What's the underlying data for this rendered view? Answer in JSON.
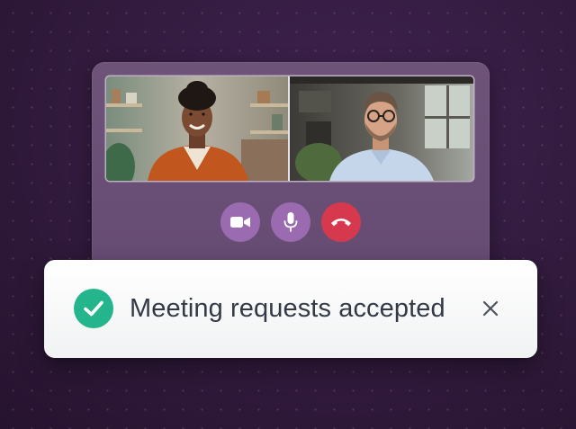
{
  "call": {
    "participants": [
      {
        "position": "left",
        "description": "woman in orange blazer"
      },
      {
        "position": "right",
        "description": "man with glasses in light blue shirt"
      }
    ],
    "controls": [
      {
        "name": "camera",
        "icon": "video-camera-icon",
        "color": "#9a6bb0"
      },
      {
        "name": "microphone",
        "icon": "microphone-icon",
        "color": "#9a6bb0"
      },
      {
        "name": "end-call",
        "icon": "hang-up-icon",
        "color": "#d6394e"
      }
    ]
  },
  "toast": {
    "message": "Meeting requests accepted",
    "status_icon": "check-circle-icon",
    "status_color": "#24b58d",
    "close_icon": "close-icon"
  }
}
